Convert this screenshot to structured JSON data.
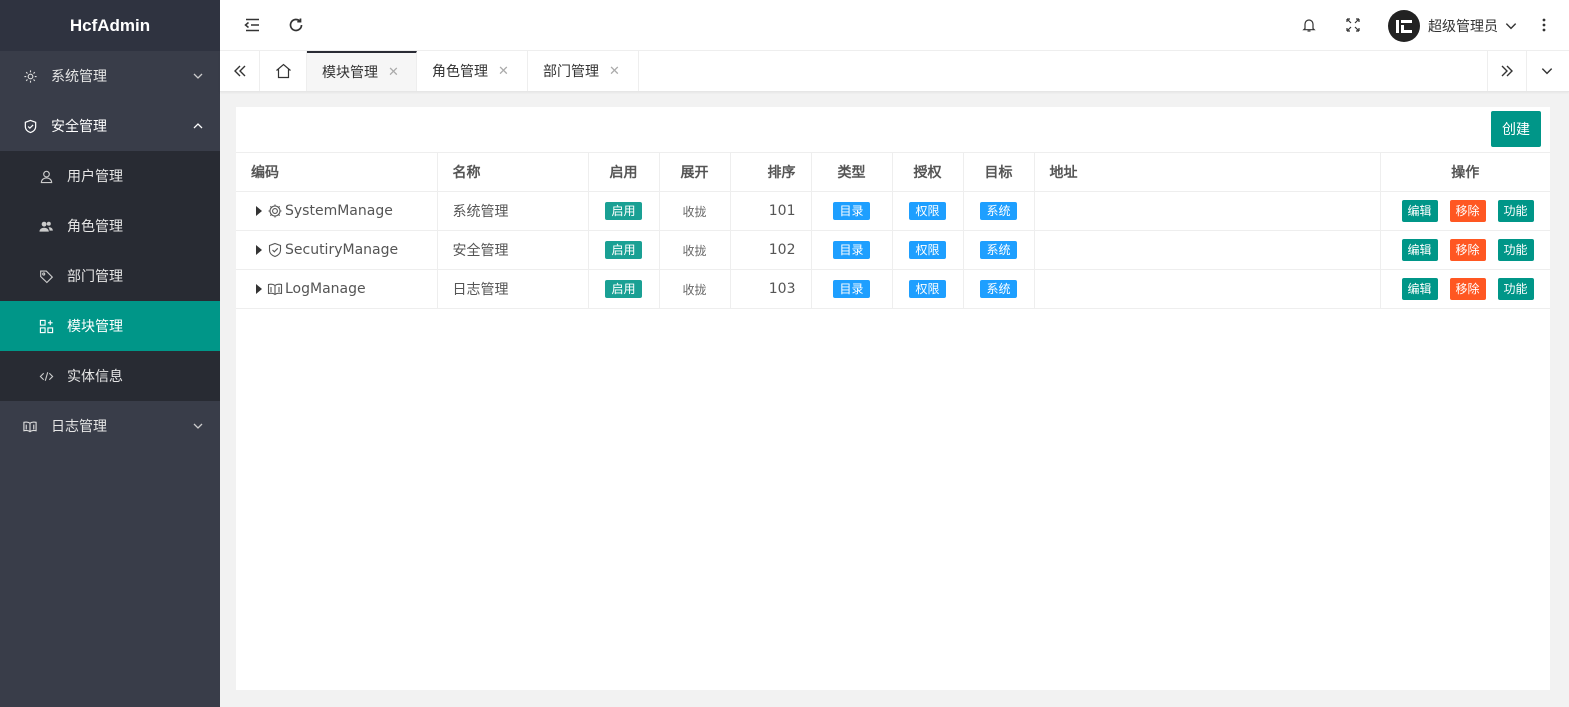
{
  "app": {
    "logo": "HcfAdmin"
  },
  "sidebar": {
    "menus": [
      {
        "label": "系统管理",
        "icon": "gear-icon",
        "expanded": false
      },
      {
        "label": "安全管理",
        "icon": "shield-icon",
        "expanded": true,
        "children": [
          {
            "label": "用户管理",
            "icon": "user-icon"
          },
          {
            "label": "角色管理",
            "icon": "users-icon"
          },
          {
            "label": "部门管理",
            "icon": "tag-icon"
          },
          {
            "label": "模块管理",
            "icon": "module-icon",
            "active": true
          },
          {
            "label": "实体信息",
            "icon": "code-icon"
          }
        ]
      },
      {
        "label": "日志管理",
        "icon": "book-icon",
        "expanded": false
      }
    ]
  },
  "header": {
    "username": "超级管理员"
  },
  "tabs": [
    {
      "label": "模块管理",
      "active": true
    },
    {
      "label": "角色管理"
    },
    {
      "label": "部门管理"
    }
  ],
  "toolbar": {
    "create_label": "创建"
  },
  "table": {
    "columns": [
      "编码",
      "名称",
      "启用",
      "展开",
      "排序",
      "类型",
      "授权",
      "目标",
      "地址",
      "操作"
    ],
    "rows": [
      {
        "code": "SystemManage",
        "name": "系统管理",
        "enabled": "启用",
        "expand": "收拢",
        "order": "101",
        "type": "目录",
        "auth": "权限",
        "target": "系统",
        "address": "",
        "icon": "gear-icon"
      },
      {
        "code": "SecutiryManage",
        "name": "安全管理",
        "enabled": "启用",
        "expand": "收拢",
        "order": "102",
        "type": "目录",
        "auth": "权限",
        "target": "系统",
        "address": "",
        "icon": "shield-icon"
      },
      {
        "code": "LogManage",
        "name": "日志管理",
        "enabled": "启用",
        "expand": "收拢",
        "order": "103",
        "type": "目录",
        "auth": "权限",
        "target": "系统",
        "address": "",
        "icon": "book-icon"
      }
    ],
    "actions": {
      "edit": "编辑",
      "remove": "移除",
      "function": "功能"
    }
  },
  "colors": {
    "accent": "#009688",
    "sidebar": "#393d49",
    "danger": "#ff5722",
    "info": "#1e9fff"
  }
}
